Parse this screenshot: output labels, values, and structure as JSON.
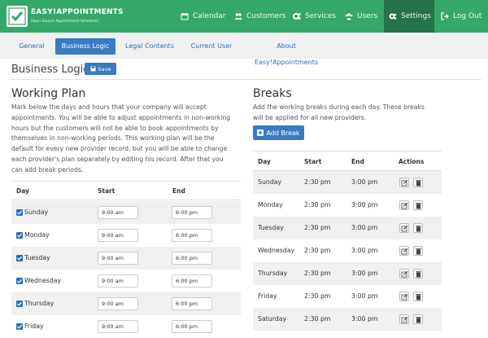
{
  "brand": {
    "title": "EASY!APPOINTMENTS",
    "subtitle": "Open Source Appointment Scheduler"
  },
  "nav": [
    {
      "label": "Calendar",
      "icon": "calendar-icon"
    },
    {
      "label": "Customers",
      "icon": "users-icon"
    },
    {
      "label": "Services",
      "icon": "cogs-icon"
    },
    {
      "label": "Users",
      "icon": "user-group-icon"
    },
    {
      "label": "Settings",
      "icon": "settings-icon",
      "active": true
    },
    {
      "label": "Log Out",
      "icon": "logout-icon"
    }
  ],
  "tabs": [
    {
      "label": "General"
    },
    {
      "label": "Business Logic",
      "active": true
    },
    {
      "label": "Legal Contents"
    },
    {
      "label": "Current User"
    },
    {
      "label": "About Easy!Appointments"
    }
  ],
  "page": {
    "title": "Business Logic",
    "save_label": "Save"
  },
  "working_plan": {
    "heading": "Working Plan",
    "lines": [
      "Mark below the days and hours that your company will accept",
      "appointments. You will be able to adjust appointments in non-working",
      "hours but the customers will not be able to book appointments by",
      "themselves in non-working periods. This working plan will be the",
      "default for every new provider record, but you will be able to change",
      "each provider's plan separately by editing his record. After that you",
      "can add break periods."
    ],
    "columns": {
      "day": "Day",
      "start": "Start",
      "end": "End"
    },
    "rows": [
      {
        "day": "Sunday",
        "start": "9:00 am",
        "end": "6:00 pm"
      },
      {
        "day": "Monday",
        "start": "9:00 am",
        "end": "6:00 pm"
      },
      {
        "day": "Tuesday",
        "start": "9:00 am",
        "end": "6:00 pm"
      },
      {
        "day": "Wednesday",
        "start": "9:00 am",
        "end": "6:00 pm"
      },
      {
        "day": "Thursday",
        "start": "9:00 am",
        "end": "6:00 pm"
      },
      {
        "day": "Friday",
        "start": "9:00 am",
        "end": "6:00 pm"
      }
    ]
  },
  "breaks": {
    "heading": "Breaks",
    "lines": [
      "Add the working breaks during each day. These breaks",
      "will be applied for all new providers."
    ],
    "add_label": "Add Break",
    "columns": {
      "day": "Day",
      "start": "Start",
      "end": "End",
      "actions": "Actions"
    },
    "rows": [
      {
        "day": "Sunday",
        "start": "2:30 pm",
        "end": "3:00 pm"
      },
      {
        "day": "Monday",
        "start": "2:30 pm",
        "end": "3:00 pm"
      },
      {
        "day": "Tuesday",
        "start": "2:30 pm",
        "end": "3:00 pm"
      },
      {
        "day": "Wednesday",
        "start": "2:30 pm",
        "end": "3:00 pm"
      },
      {
        "day": "Thursday",
        "start": "2:30 pm",
        "end": "3:00 pm"
      },
      {
        "day": "Friday",
        "start": "2:30 pm",
        "end": "3:00 pm"
      },
      {
        "day": "Saturday",
        "start": "2:30 pm",
        "end": "3:00 pm"
      }
    ]
  },
  "colors": {
    "header": "#35a768",
    "header_active": "#247248",
    "primary": "#3a7ac0"
  }
}
